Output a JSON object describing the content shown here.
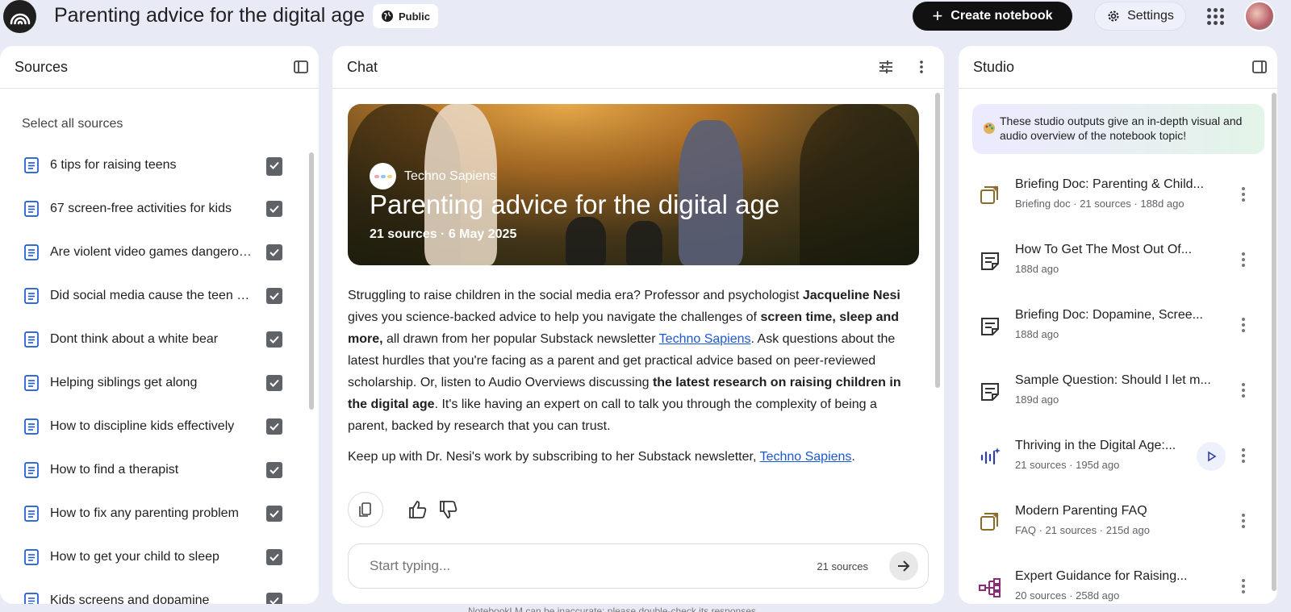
{
  "header": {
    "title": "Parenting advice for the digital age",
    "public_label": "Public",
    "create_label": "Create notebook",
    "settings_label": "Settings"
  },
  "sources": {
    "title": "Sources",
    "select_all": "Select all sources",
    "items": [
      {
        "label": "6 tips for raising teens"
      },
      {
        "label": "67 screen-free activities for kids"
      },
      {
        "label": "Are violent video games dangerous"
      },
      {
        "label": "Did social media cause the teen mental health crisis"
      },
      {
        "label": "Dont think about a white bear"
      },
      {
        "label": "Helping siblings get along"
      },
      {
        "label": "How to discipline kids effectively"
      },
      {
        "label": "How to find a therapist"
      },
      {
        "label": "How to fix any parenting problem"
      },
      {
        "label": "How to get your child to sleep"
      },
      {
        "label": "Kids screens and dopamine"
      }
    ]
  },
  "chat": {
    "title": "Chat",
    "hero": {
      "source_name": "Techno Sapiens",
      "title": "Parenting advice for the digital age",
      "meta": "21 sources · 6 May 2025"
    },
    "paragraph1": {
      "t1": "Struggling to raise children in the social media era? Professor and psychologist ",
      "b1": "Jacqueline Nesi",
      "t2": " gives you science-backed advice to help you navigate the challenges of ",
      "b2": "screen time, sleep and more,",
      "t3": " all drawn from her popular Substack newsletter ",
      "link": "Techno Sapiens",
      "t4": ". Ask questions about the latest hurdles that you're facing as a parent and get practical advice based on peer-reviewed scholarship. Or, listen to Audio Overviews discussing ",
      "b3": "the latest research on raising children in the digital age",
      "t5": ". It's like having an expert on call to talk you through the complexity of being a parent, backed by research that you can trust."
    },
    "paragraph2": {
      "t1": "Keep up with Dr. Nesi's work by subscribing to her Substack newsletter, ",
      "link": "Techno Sapiens",
      "t2": "."
    },
    "input_placeholder": "Start typing...",
    "input_sources": "21 sources"
  },
  "studio": {
    "title": "Studio",
    "banner": "These studio outputs give an in-depth visual and audio overview of the notebook topic!",
    "items": [
      {
        "title": "Briefing Doc: Parenting & Child...",
        "meta": "Briefing doc · 21 sources · 188d ago",
        "icon": "briefing-doc-icon"
      },
      {
        "title": "How To Get The Most Out Of...",
        "meta": "188d ago",
        "icon": "note-icon"
      },
      {
        "title": "Briefing Doc: Dopamine, Scree...",
        "meta": "188d ago",
        "icon": "note-icon"
      },
      {
        "title": "Sample Question: Should I let m...",
        "meta": "189d ago",
        "icon": "note-icon"
      },
      {
        "title": "Thriving in the Digital Age:...",
        "meta": "21 sources · 195d ago",
        "icon": "audio-overview-icon"
      },
      {
        "title": "Modern Parenting FAQ",
        "meta": "FAQ · 21 sources · 215d ago",
        "icon": "faq-icon"
      },
      {
        "title": "Expert Guidance for Raising...",
        "meta": "20 sources · 258d ago",
        "icon": "mind-map-icon"
      }
    ]
  },
  "footer_note": "NotebookLM can be inaccurate; please double-check its responses."
}
